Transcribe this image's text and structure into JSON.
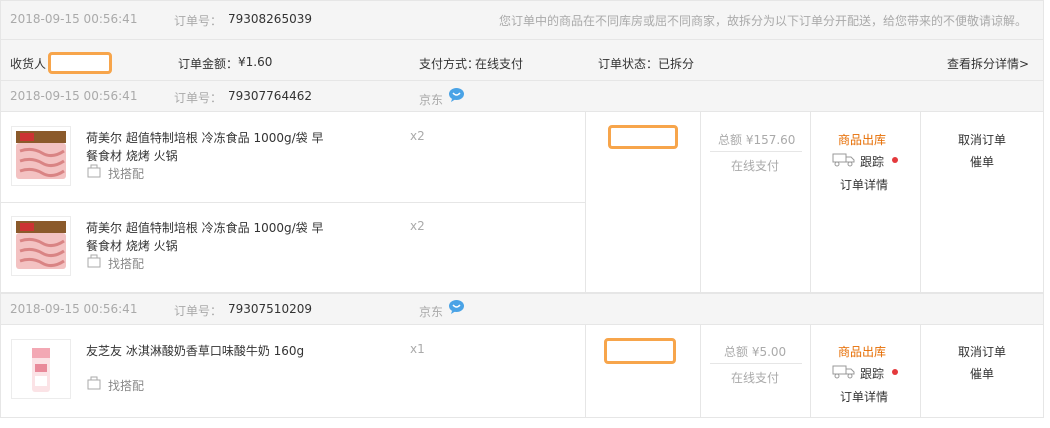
{
  "order": {
    "time": "2018-09-15 00:56:41",
    "number_label": "订单号：",
    "number": "79308265039",
    "split_notice": "您订单中的商品在不同库房或屈不同商家，故拆分为以下订单分开配送，给您带来的不便敬请谅解。",
    "recipient_label": "收货人",
    "amount_label": "订单金额：",
    "amount": "¥1.60",
    "payment_label": "支付方式：",
    "payment": "在线支付",
    "status_label": "订单状态：",
    "status": "已拆分",
    "split_details_link": "查看拆分详情>"
  },
  "suborders": [
    {
      "time": "2018-09-15 00:56:41",
      "number_label": "订单号：",
      "number": "79307764462",
      "shop": "京东",
      "items": [
        {
          "title_line1": "荷美尔 超值特制培根 冷冻食品 1000g/袋 早",
          "title_line2": "餐食材 烧烤 火锅",
          "quantity": "x2",
          "match_label": "找搭配"
        },
        {
          "title_line1": "荷美尔 超值特制培根 冷冻食品 1000g/袋 早",
          "title_line2": "餐食材 烧烤 火锅",
          "quantity": "x2",
          "match_label": "找搭配"
        }
      ],
      "total": "总额 ¥157.60",
      "pay_method": "在线支付",
      "status": "商品出库",
      "track": "跟踪",
      "detail": "订单详情",
      "cancel": "取消订单",
      "urge": "催单"
    },
    {
      "time": "2018-09-15 00:56:41",
      "number_label": "订单号：",
      "number": "79307510209",
      "shop": "京东",
      "items": [
        {
          "title_line1": "友芝友 冰淇淋酸奶香草口味酸牛奶 160g",
          "title_line2": "",
          "quantity": "x1",
          "match_label": "找搭配"
        }
      ],
      "total": "总额 ¥5.00",
      "pay_method": "在线支付",
      "status": "商品出库",
      "track": "跟踪",
      "detail": "订单详情",
      "cancel": "取消订单",
      "urge": "催单"
    }
  ],
  "colors": {
    "status": "#e66c00",
    "redaction": "#f7a54b",
    "dot": "#e4393c",
    "header_bg": "#f5f5f5"
  }
}
